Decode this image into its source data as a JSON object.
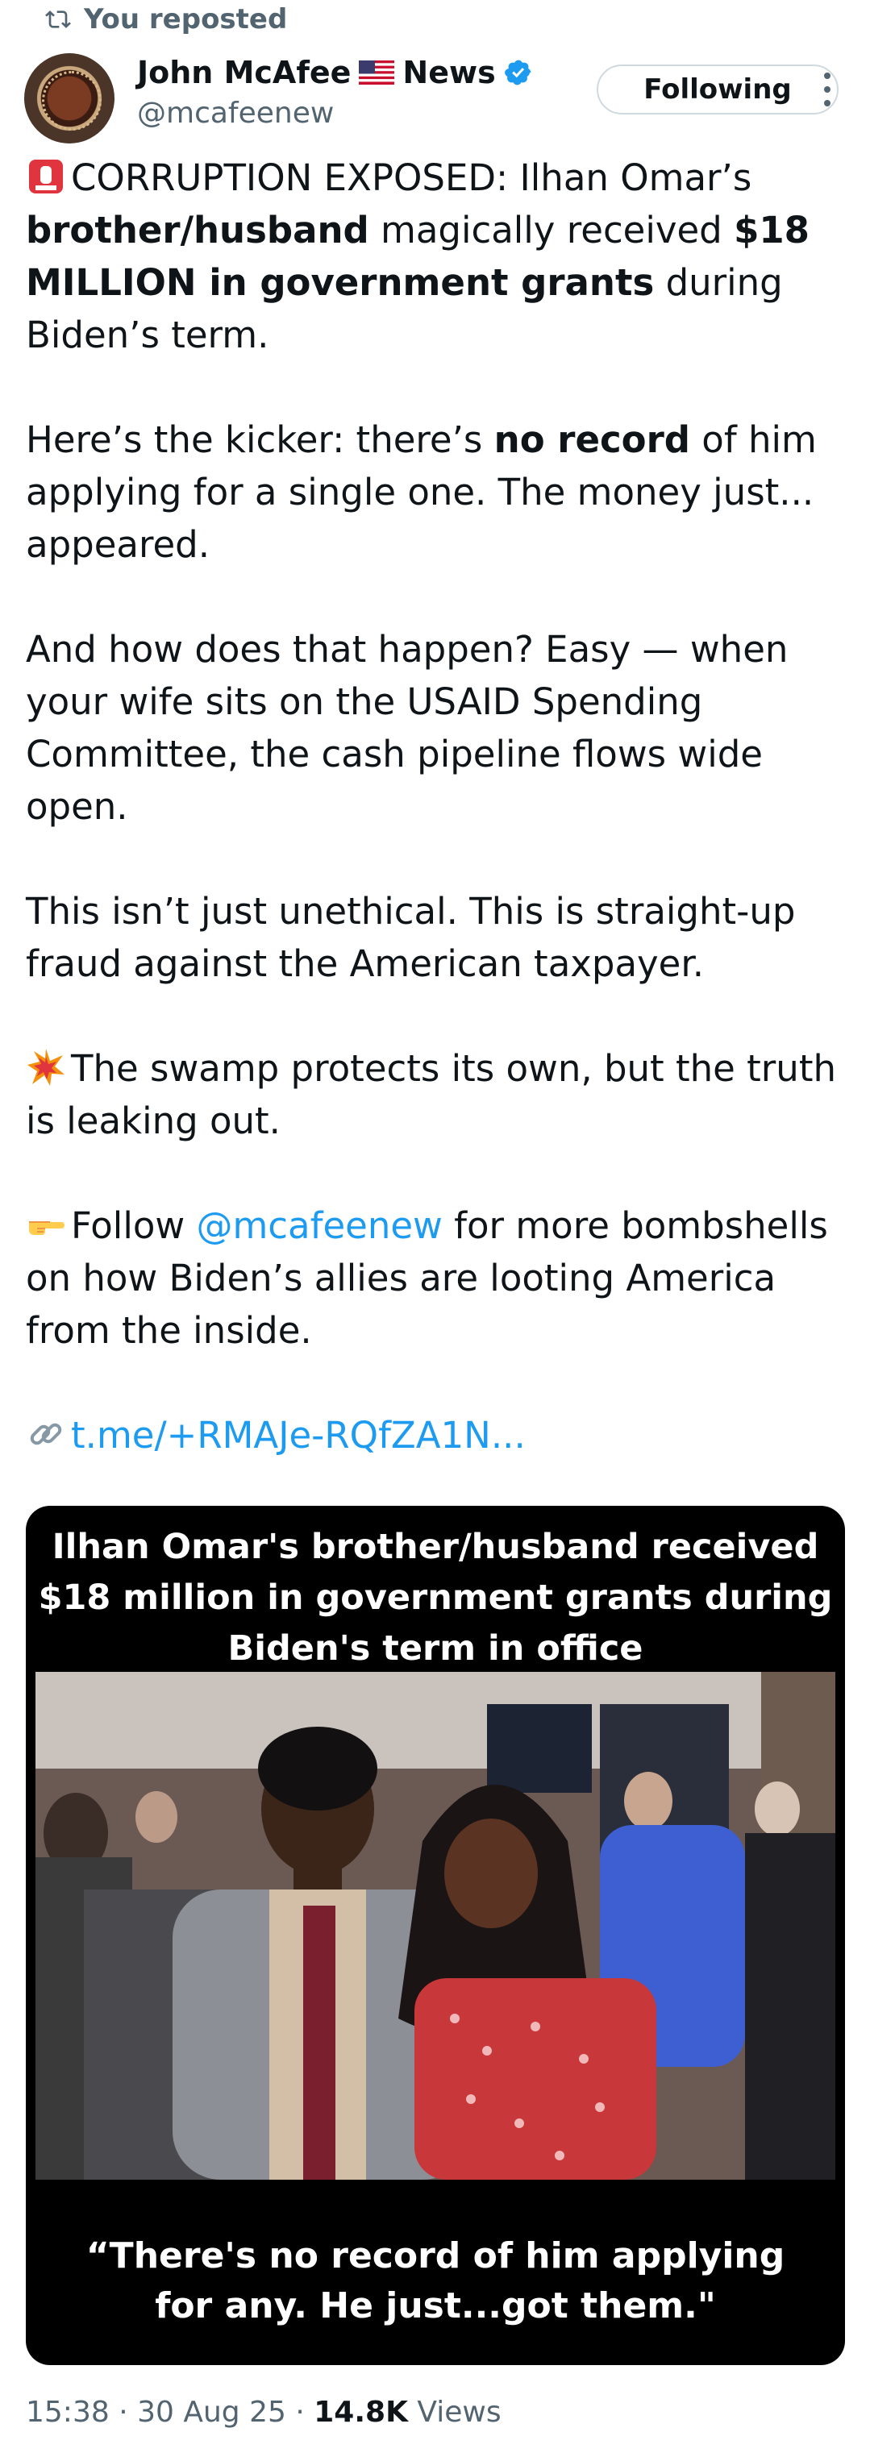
{
  "repost": {
    "label": "You reposted",
    "icon": "repost-icon"
  },
  "author": {
    "name": "John McAfee",
    "flag": "us-flag-icon",
    "suffix": "News",
    "handle": "@mcafeenew",
    "verified": true
  },
  "follow_button": "Following",
  "tweet": {
    "p1_emoji": "rotating-light-emoji",
    "p1_a": "CORRUPTION EXPOSED: Ilhan Omar’s ",
    "p1_b": "brother/husband",
    "p1_c": " magically received ",
    "p1_d": "$18 MILLION in government grants",
    "p1_e": " during Biden’s term.",
    "p2_a": "Here’s the kicker: there’s ",
    "p2_b": "no record",
    "p2_c": " of him applying for a single one. The money just... appeared.",
    "p3": "And how does that happen? Easy — when your wife sits on the USAID Spending Committee, the cash pipeline flows wide open.",
    "p4": "This isn’t just unethical. This is straight-up fraud against the American taxpayer.",
    "p5_emoji": "collision-emoji",
    "p5": "The swamp protects its own, but the truth is leaking out.",
    "p6_emoji": "pointing-hand-emoji",
    "p6_a": "Follow ",
    "p6_mention": "@mcafeenew",
    "p6_b": " for more bombshells on how Biden’s allies are looting America from the inside.",
    "link_emoji": "link-emoji",
    "link": "t.me/+RMAJe-RQfZA1N..."
  },
  "media": {
    "top_line1": "Ilhan Omar's brother/husband received",
    "top_line2": "$18 million in government grants during",
    "top_line3": "Biden's term in office",
    "bottom_line1": "“There's no record of him applying",
    "bottom_line2": "for any. He just...got them.\""
  },
  "meta": {
    "time": "15:38",
    "date": "30 Aug 25",
    "views_count": "14.8K",
    "views_label": "Views"
  },
  "colors": {
    "link": "#1d9bf0",
    "secondary": "#536471",
    "verified": "#1d9bf0"
  }
}
